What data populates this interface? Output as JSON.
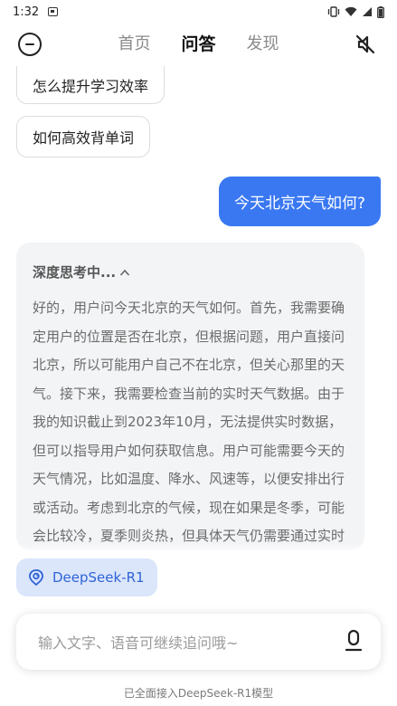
{
  "status_bar": {
    "time": "1:32"
  },
  "nav": {
    "tabs": [
      "首页",
      "问答",
      "发现"
    ],
    "active_tab": "问答"
  },
  "suggestions": [
    "怎么提升学习效率",
    "如何高效背单词"
  ],
  "user_message": "今天北京天气如何?",
  "thinking": {
    "title": "深度思考中...",
    "text": "好的，用户问今天北京的天气如何。首先，我需要确定用户的位置是否在北京，但根据问题，用户直接问北京，所以可能用户自己不在北京，但关心那里的天气。接下来，我需要检查当前的实时天气数据。由于我的知识截止到2023年10月，无法提供实时数据，但可以指导用户如何获取信息。用户可能需要今天的天气情况，比如温度、降水、风速等，以便安排出行或活动。考虑到北京的气候，现在如果是冬季，可能会比较冷，夏季则炎热，但具体天气仍需要通过实时数据确认"
  },
  "model_pill": {
    "label": "DeepSeek-R1"
  },
  "input": {
    "placeholder": "输入文字、语音可继续追问哦~"
  },
  "footer": "已全面接入DeepSeek-R1模型",
  "colors": {
    "accent": "#3a78f2",
    "pill_bg": "#dbe6fb",
    "pill_text": "#2f63d6"
  }
}
